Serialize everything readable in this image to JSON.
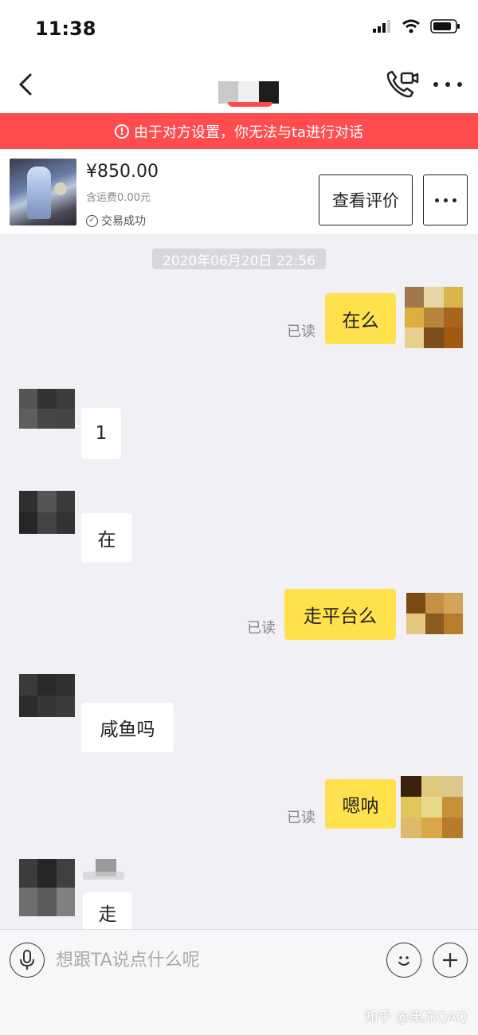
{
  "status_bar": {
    "time": "11:38"
  },
  "nav": {
    "back_label": "",
    "more_label": ""
  },
  "warning": {
    "icon_text": "!",
    "text": "由于对方设置，你无法与ta进行对话"
  },
  "product": {
    "price": "¥850.00",
    "shipping": "含运费0.00元",
    "status": "交易成功",
    "review_button": "查看评价"
  },
  "chat": {
    "timestamp": "2020年06月20日 22:56",
    "messages": [
      {
        "side": "mine",
        "text": "在么",
        "read": "已读"
      },
      {
        "side": "theirs",
        "text": "1"
      },
      {
        "side": "theirs",
        "text": "在"
      },
      {
        "side": "mine",
        "text": "走平台么",
        "read": "已读"
      },
      {
        "side": "theirs",
        "text": "咸鱼吗"
      },
      {
        "side": "mine",
        "text": "嗯呐",
        "read": "已读"
      },
      {
        "side": "theirs",
        "text": "走"
      }
    ]
  },
  "input": {
    "placeholder": "想跟TA说点什么呢"
  },
  "watermark": "知乎 @果冻QAQ",
  "colors": {
    "banner": "#ff4d4f",
    "my_bubble": "#ffe14d",
    "their_bubble": "#ffffff",
    "background": "#f1f1f5"
  }
}
